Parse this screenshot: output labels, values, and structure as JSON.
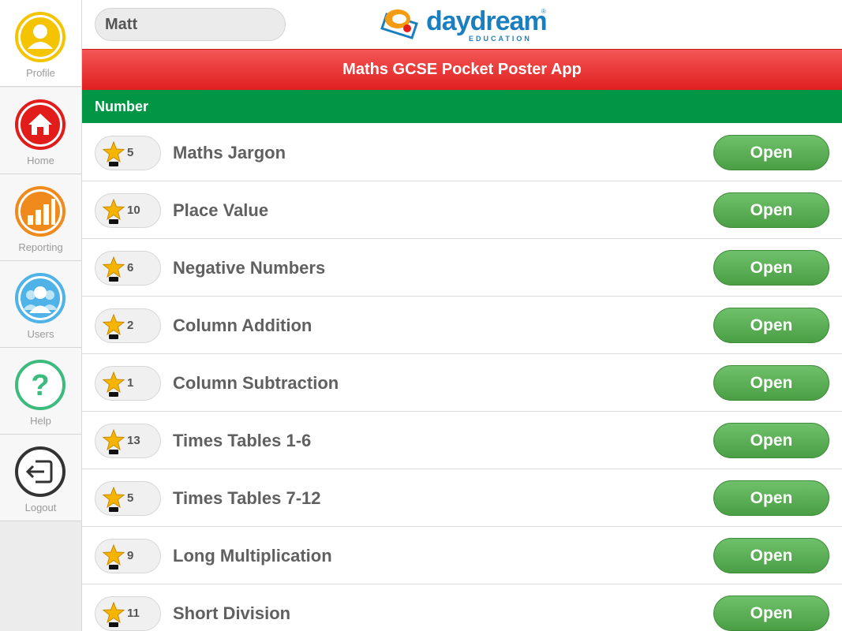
{
  "sidebar": {
    "items": [
      {
        "label": "Profile",
        "icon": "profile-icon",
        "color": "#f5c400"
      },
      {
        "label": "Home",
        "icon": "home-icon",
        "color": "#e21b1b"
      },
      {
        "label": "Reporting",
        "icon": "bar-chart-icon",
        "color": "#f08a1c"
      },
      {
        "label": "Users",
        "icon": "users-icon",
        "color": "#4fb3e8"
      },
      {
        "label": "Help",
        "icon": "help-icon",
        "color": "#3dbb7e"
      },
      {
        "label": "Logout",
        "icon": "logout-icon",
        "color": "#333333"
      }
    ]
  },
  "header": {
    "user_name": "Matt",
    "logo_text": "daydream",
    "logo_sub": "EDUCATION"
  },
  "title": "Maths GCSE Pocket Poster App",
  "section": "Number",
  "open_label": "Open",
  "topics": [
    {
      "name": "Maths Jargon",
      "stars": "5"
    },
    {
      "name": "Place Value",
      "stars": "10"
    },
    {
      "name": "Negative Numbers",
      "stars": "6"
    },
    {
      "name": "Column Addition",
      "stars": "2"
    },
    {
      "name": "Column Subtraction",
      "stars": "1"
    },
    {
      "name": "Times Tables 1-6",
      "stars": "13"
    },
    {
      "name": "Times Tables 7-12",
      "stars": "5"
    },
    {
      "name": "Long Multiplication",
      "stars": "9"
    },
    {
      "name": "Short Division",
      "stars": "11"
    }
  ],
  "colors": {
    "title_bar": "#e92f2f",
    "section_bar": "#009645",
    "open_button": "#5cb357"
  }
}
